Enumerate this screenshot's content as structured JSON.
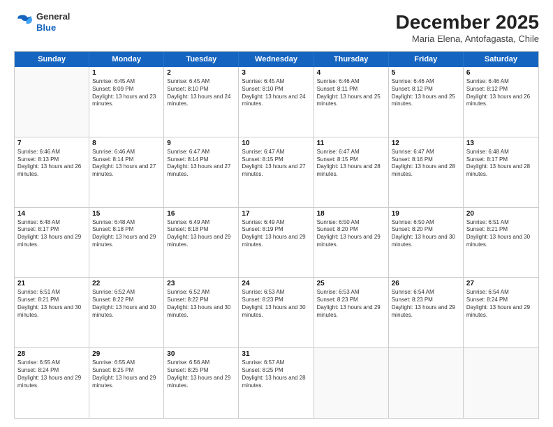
{
  "logo": {
    "general": "General",
    "blue": "Blue"
  },
  "title": "December 2025",
  "subtitle": "Maria Elena, Antofagasta, Chile",
  "header_days": [
    "Sunday",
    "Monday",
    "Tuesday",
    "Wednesday",
    "Thursday",
    "Friday",
    "Saturday"
  ],
  "weeks": [
    [
      {
        "day": "",
        "sunrise": "",
        "sunset": "",
        "daylight": ""
      },
      {
        "day": "1",
        "sunrise": "Sunrise: 6:45 AM",
        "sunset": "Sunset: 8:09 PM",
        "daylight": "Daylight: 13 hours and 23 minutes."
      },
      {
        "day": "2",
        "sunrise": "Sunrise: 6:45 AM",
        "sunset": "Sunset: 8:10 PM",
        "daylight": "Daylight: 13 hours and 24 minutes."
      },
      {
        "day": "3",
        "sunrise": "Sunrise: 6:45 AM",
        "sunset": "Sunset: 8:10 PM",
        "daylight": "Daylight: 13 hours and 24 minutes."
      },
      {
        "day": "4",
        "sunrise": "Sunrise: 6:46 AM",
        "sunset": "Sunset: 8:11 PM",
        "daylight": "Daylight: 13 hours and 25 minutes."
      },
      {
        "day": "5",
        "sunrise": "Sunrise: 6:46 AM",
        "sunset": "Sunset: 8:12 PM",
        "daylight": "Daylight: 13 hours and 25 minutes."
      },
      {
        "day": "6",
        "sunrise": "Sunrise: 6:46 AM",
        "sunset": "Sunset: 8:12 PM",
        "daylight": "Daylight: 13 hours and 26 minutes."
      }
    ],
    [
      {
        "day": "7",
        "sunrise": "Sunrise: 6:46 AM",
        "sunset": "Sunset: 8:13 PM",
        "daylight": "Daylight: 13 hours and 26 minutes."
      },
      {
        "day": "8",
        "sunrise": "Sunrise: 6:46 AM",
        "sunset": "Sunset: 8:14 PM",
        "daylight": "Daylight: 13 hours and 27 minutes."
      },
      {
        "day": "9",
        "sunrise": "Sunrise: 6:47 AM",
        "sunset": "Sunset: 8:14 PM",
        "daylight": "Daylight: 13 hours and 27 minutes."
      },
      {
        "day": "10",
        "sunrise": "Sunrise: 6:47 AM",
        "sunset": "Sunset: 8:15 PM",
        "daylight": "Daylight: 13 hours and 27 minutes."
      },
      {
        "day": "11",
        "sunrise": "Sunrise: 6:47 AM",
        "sunset": "Sunset: 8:15 PM",
        "daylight": "Daylight: 13 hours and 28 minutes."
      },
      {
        "day": "12",
        "sunrise": "Sunrise: 6:47 AM",
        "sunset": "Sunset: 8:16 PM",
        "daylight": "Daylight: 13 hours and 28 minutes."
      },
      {
        "day": "13",
        "sunrise": "Sunrise: 6:48 AM",
        "sunset": "Sunset: 8:17 PM",
        "daylight": "Daylight: 13 hours and 28 minutes."
      }
    ],
    [
      {
        "day": "14",
        "sunrise": "Sunrise: 6:48 AM",
        "sunset": "Sunset: 8:17 PM",
        "daylight": "Daylight: 13 hours and 29 minutes."
      },
      {
        "day": "15",
        "sunrise": "Sunrise: 6:48 AM",
        "sunset": "Sunset: 8:18 PM",
        "daylight": "Daylight: 13 hours and 29 minutes."
      },
      {
        "day": "16",
        "sunrise": "Sunrise: 6:49 AM",
        "sunset": "Sunset: 8:18 PM",
        "daylight": "Daylight: 13 hours and 29 minutes."
      },
      {
        "day": "17",
        "sunrise": "Sunrise: 6:49 AM",
        "sunset": "Sunset: 8:19 PM",
        "daylight": "Daylight: 13 hours and 29 minutes."
      },
      {
        "day": "18",
        "sunrise": "Sunrise: 6:50 AM",
        "sunset": "Sunset: 8:20 PM",
        "daylight": "Daylight: 13 hours and 29 minutes."
      },
      {
        "day": "19",
        "sunrise": "Sunrise: 6:50 AM",
        "sunset": "Sunset: 8:20 PM",
        "daylight": "Daylight: 13 hours and 30 minutes."
      },
      {
        "day": "20",
        "sunrise": "Sunrise: 6:51 AM",
        "sunset": "Sunset: 8:21 PM",
        "daylight": "Daylight: 13 hours and 30 minutes."
      }
    ],
    [
      {
        "day": "21",
        "sunrise": "Sunrise: 6:51 AM",
        "sunset": "Sunset: 8:21 PM",
        "daylight": "Daylight: 13 hours and 30 minutes."
      },
      {
        "day": "22",
        "sunrise": "Sunrise: 6:52 AM",
        "sunset": "Sunset: 8:22 PM",
        "daylight": "Daylight: 13 hours and 30 minutes."
      },
      {
        "day": "23",
        "sunrise": "Sunrise: 6:52 AM",
        "sunset": "Sunset: 8:22 PM",
        "daylight": "Daylight: 13 hours and 30 minutes."
      },
      {
        "day": "24",
        "sunrise": "Sunrise: 6:53 AM",
        "sunset": "Sunset: 8:23 PM",
        "daylight": "Daylight: 13 hours and 30 minutes."
      },
      {
        "day": "25",
        "sunrise": "Sunrise: 6:53 AM",
        "sunset": "Sunset: 8:23 PM",
        "daylight": "Daylight: 13 hours and 29 minutes."
      },
      {
        "day": "26",
        "sunrise": "Sunrise: 6:54 AM",
        "sunset": "Sunset: 8:23 PM",
        "daylight": "Daylight: 13 hours and 29 minutes."
      },
      {
        "day": "27",
        "sunrise": "Sunrise: 6:54 AM",
        "sunset": "Sunset: 8:24 PM",
        "daylight": "Daylight: 13 hours and 29 minutes."
      }
    ],
    [
      {
        "day": "28",
        "sunrise": "Sunrise: 6:55 AM",
        "sunset": "Sunset: 8:24 PM",
        "daylight": "Daylight: 13 hours and 29 minutes."
      },
      {
        "day": "29",
        "sunrise": "Sunrise: 6:55 AM",
        "sunset": "Sunset: 8:25 PM",
        "daylight": "Daylight: 13 hours and 29 minutes."
      },
      {
        "day": "30",
        "sunrise": "Sunrise: 6:56 AM",
        "sunset": "Sunset: 8:25 PM",
        "daylight": "Daylight: 13 hours and 29 minutes."
      },
      {
        "day": "31",
        "sunrise": "Sunrise: 6:57 AM",
        "sunset": "Sunset: 8:25 PM",
        "daylight": "Daylight: 13 hours and 28 minutes."
      },
      {
        "day": "",
        "sunrise": "",
        "sunset": "",
        "daylight": ""
      },
      {
        "day": "",
        "sunrise": "",
        "sunset": "",
        "daylight": ""
      },
      {
        "day": "",
        "sunrise": "",
        "sunset": "",
        "daylight": ""
      }
    ]
  ]
}
